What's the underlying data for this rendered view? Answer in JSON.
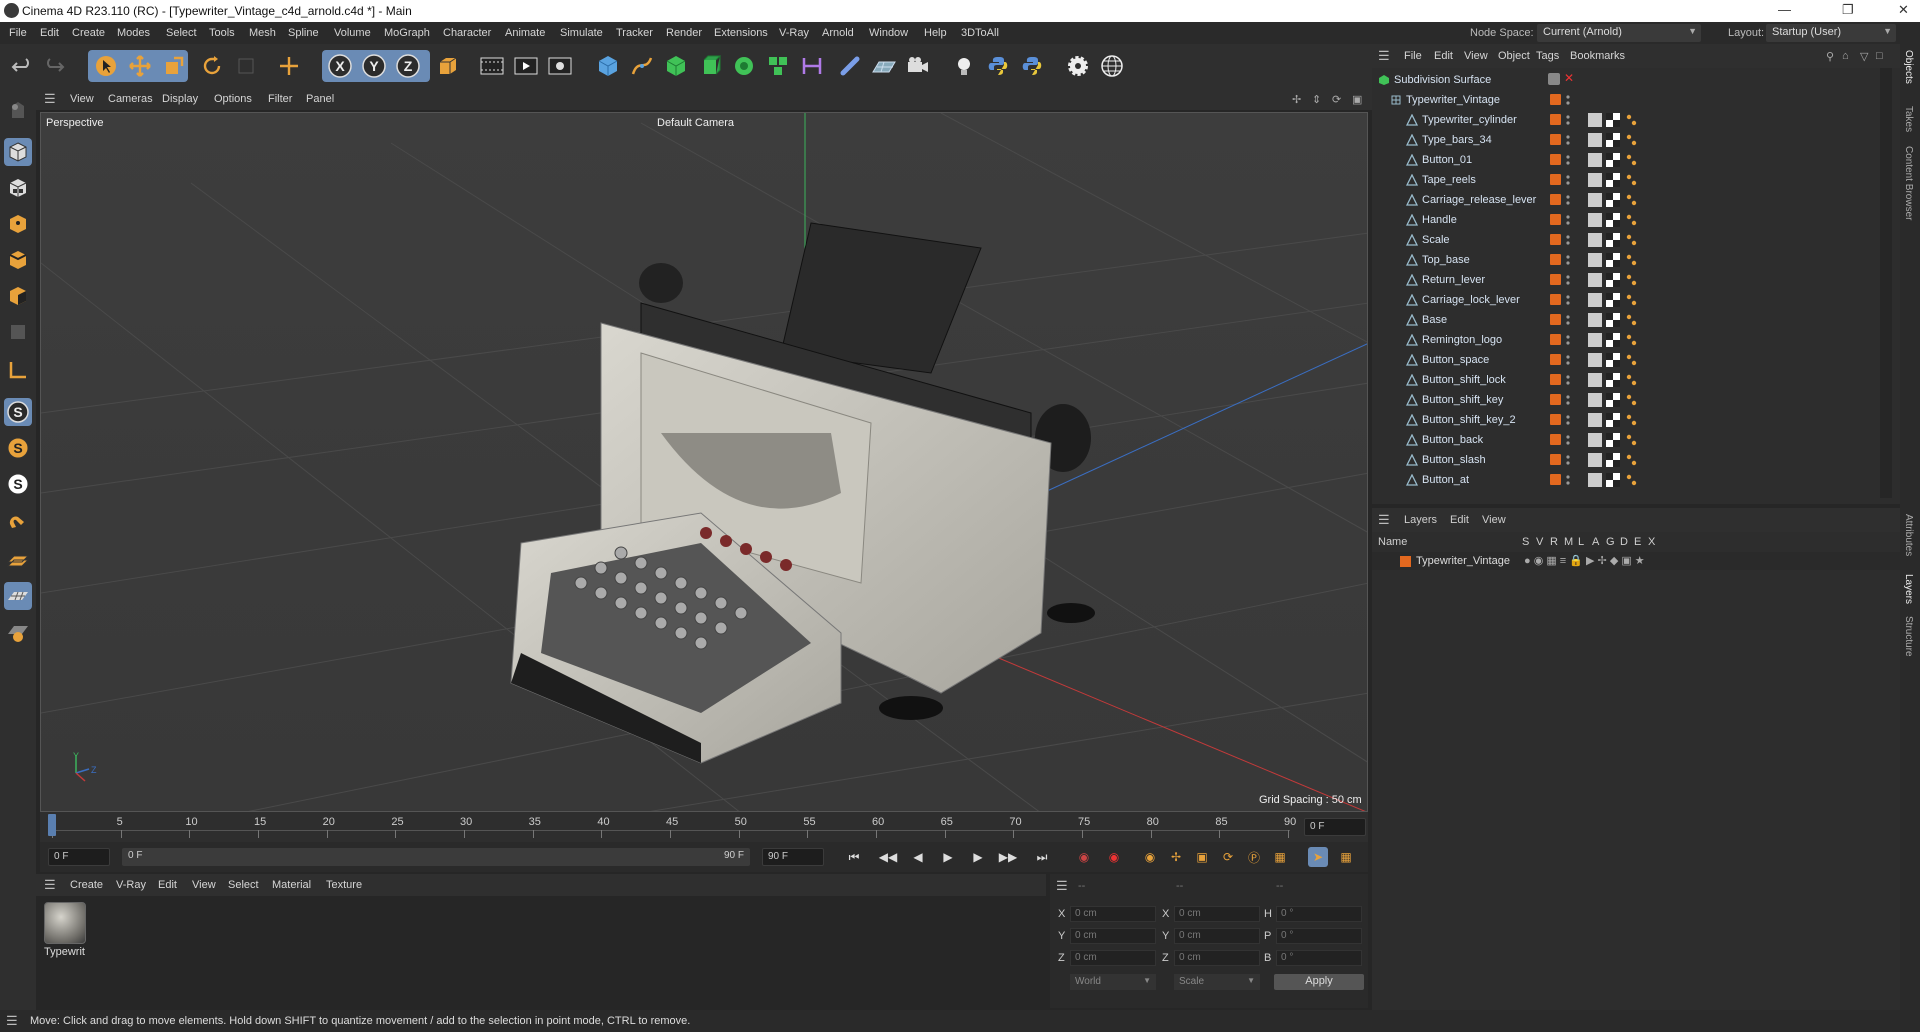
{
  "window": {
    "title": "Cinema 4D R23.110 (RC) - [Typewriter_Vintage_c4d_arnold.c4d *] - Main"
  },
  "menubar": {
    "items": [
      "File",
      "Edit",
      "Create",
      "Modes",
      "Select",
      "Tools",
      "Mesh",
      "Spline",
      "Volume",
      "MoGraph",
      "Character",
      "Animate",
      "Simulate",
      "Tracker",
      "Render",
      "Extensions",
      "V-Ray",
      "Arnold",
      "Window",
      "Help",
      "3DToAll"
    ],
    "node_space_label": "Node Space:",
    "node_space_value": "Current (Arnold)",
    "layout_label": "Layout:",
    "layout_value": "Startup (User)"
  },
  "viewport": {
    "menu": [
      "View",
      "Cameras",
      "Display",
      "Options",
      "Filter",
      "Panel"
    ],
    "view_name": "Perspective",
    "camera": "Default Camera",
    "grid_spacing": "Grid Spacing : 50 cm",
    "axis_labels": {
      "y": "Y",
      "z": "Z"
    }
  },
  "timeline": {
    "ticks": [
      "0",
      "5",
      "10",
      "15",
      "20",
      "25",
      "30",
      "35",
      "40",
      "45",
      "50",
      "55",
      "60",
      "65",
      "70",
      "75",
      "80",
      "85",
      "90"
    ],
    "current_frame": "0 F",
    "start_field": "0 F",
    "range_start": "0 F",
    "range_end": "90 F",
    "end_field": "90 F",
    "right_field": "0 F"
  },
  "material_manager": {
    "menu": [
      "Create",
      "V-Ray",
      "Edit",
      "View",
      "Select",
      "Material",
      "Texture"
    ],
    "materials": [
      {
        "name": "Typewrit"
      }
    ]
  },
  "coordinates": {
    "header": [
      "--",
      "--",
      "--"
    ],
    "rows": [
      {
        "a_label": "X",
        "a_val": "0 cm",
        "b_label": "X",
        "b_val": "0 cm",
        "c_label": "H",
        "c_val": "0 °"
      },
      {
        "a_label": "Y",
        "a_val": "0 cm",
        "b_label": "Y",
        "b_val": "0 cm",
        "c_label": "P",
        "c_val": "0 °"
      },
      {
        "a_label": "Z",
        "a_val": "0 cm",
        "b_label": "Z",
        "b_val": "0 cm",
        "c_label": "B",
        "c_val": "0 °"
      }
    ],
    "space": "World",
    "mode": "Scale",
    "apply": "Apply"
  },
  "object_manager": {
    "menu": [
      "File",
      "Edit",
      "View",
      "Object",
      "Tags",
      "Bookmarks"
    ],
    "root": "Subdivision Surface",
    "group": "Typewriter_Vintage",
    "objects": [
      "Typewriter_cylinder",
      "Type_bars_34",
      "Button_01",
      "Tape_reels",
      "Carriage_release_lever",
      "Handle",
      "Scale",
      "Top_base",
      "Return_lever",
      "Carriage_lock_lever",
      "Base",
      "Remington_logo",
      "Button_space",
      "Button_shift_lock",
      "Button_shift_key",
      "Button_shift_key_2",
      "Button_back",
      "Button_slash",
      "Button_at"
    ],
    "accent_color": "#e2681f"
  },
  "layer_manager": {
    "menu": [
      "Layers",
      "Edit",
      "View"
    ],
    "columns": [
      "Name",
      "S",
      "V",
      "R",
      "M",
      "L",
      "A",
      "G",
      "D",
      "E",
      "X"
    ],
    "layers": [
      {
        "name": "Typewriter_Vintage"
      }
    ]
  },
  "side_tabs": [
    "Objects",
    "Takes",
    "Content Browser",
    "Attributes",
    "Layers",
    "Structure"
  ],
  "statusbar": {
    "text": "Move: Click and drag to move elements. Hold down SHIFT to quantize movement / add to the selection in point mode, CTRL to remove."
  }
}
